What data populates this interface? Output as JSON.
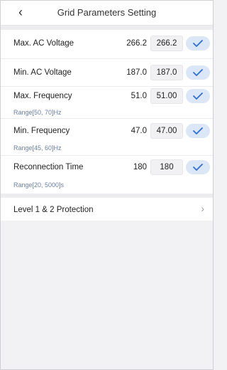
{
  "header": {
    "title": "Grid Parameters Setting",
    "back_icon": "chevron-left-icon"
  },
  "params": [
    {
      "label": "Max. AC Voltage",
      "current": "266.2",
      "input": "266.2",
      "range": ""
    },
    {
      "label": "Min. AC Voltage",
      "current": "187.0",
      "input": "187.0",
      "range": ""
    },
    {
      "label": "Max. Frequency",
      "current": "51.0",
      "input": "51.00",
      "range": "Range[50, 70]Hz"
    },
    {
      "label": "Min. Frequency",
      "current": "47.0",
      "input": "47.00",
      "range": "Range[45, 60]Hz"
    },
    {
      "label": "Reconnection Time",
      "current": "180",
      "input": "180",
      "range": "Range[20, 5000]s"
    }
  ],
  "protection": {
    "label": "Level 1 & 2 Protection",
    "chevron": "chevron-right-icon"
  },
  "colors": {
    "accent": "#2f6fd6",
    "confirm_bg": "#dbe7f7",
    "range_text": "#6a7fa2",
    "page_bg": "#f2f2f5"
  }
}
